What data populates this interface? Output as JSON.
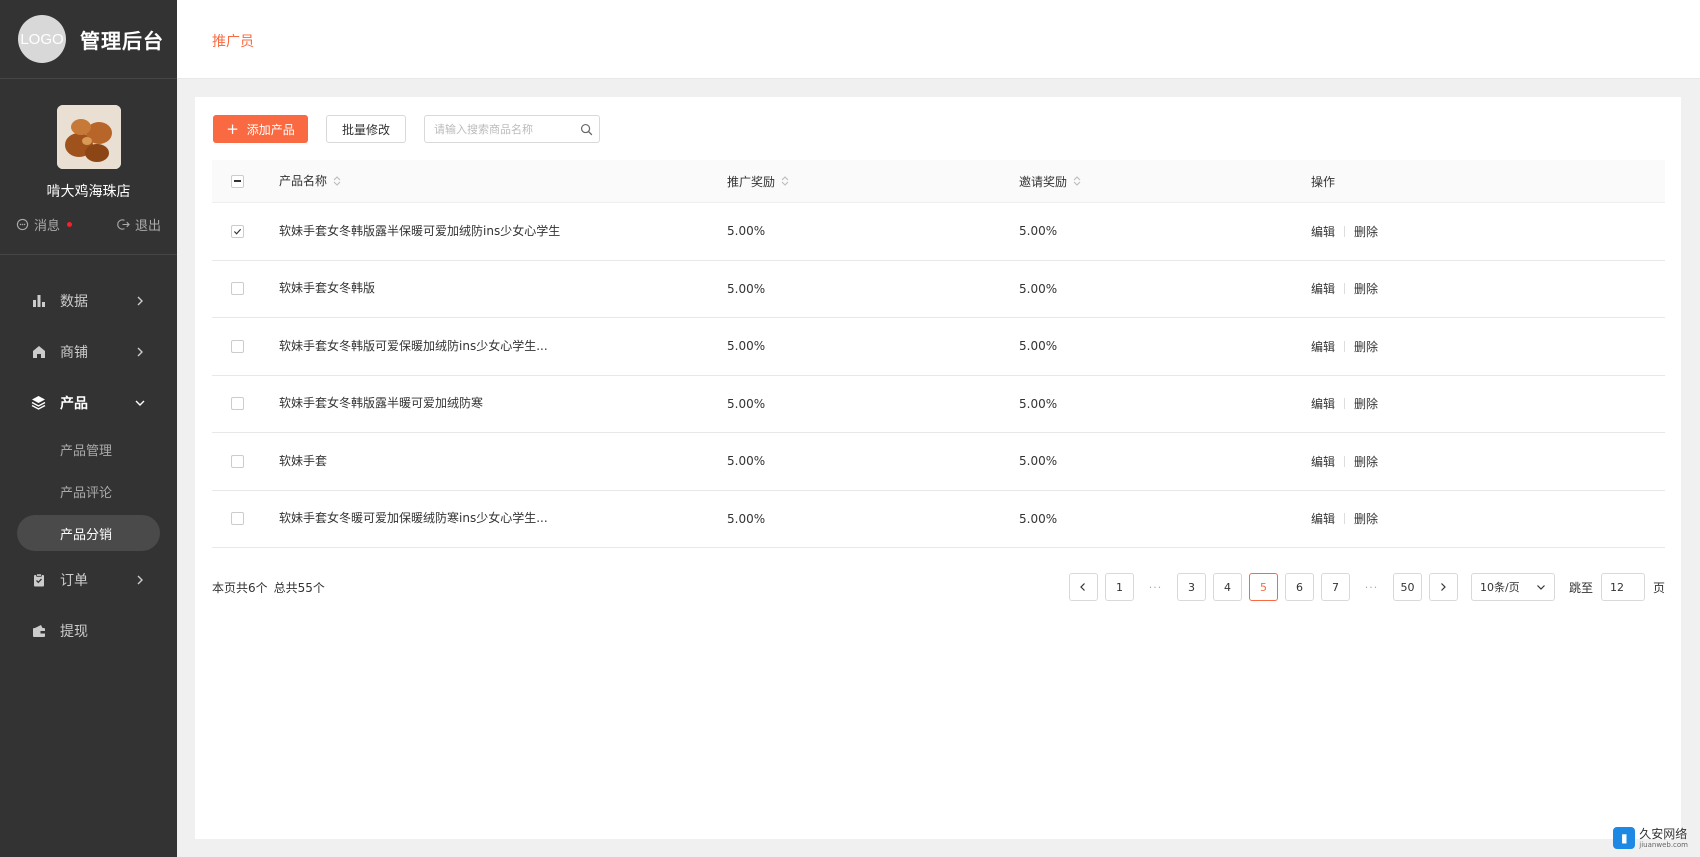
{
  "brand": {
    "logo_text": "LOGO",
    "title": "管理后台"
  },
  "profile": {
    "shop_name": "啃大鸡海珠店",
    "messages_label": "消息",
    "logout_label": "退出"
  },
  "menu": {
    "data": "数据",
    "shop": "商铺",
    "product": "产品",
    "product_sub": [
      "产品管理",
      "产品评论",
      "产品分销"
    ],
    "orders": "订单",
    "withdraw": "提现"
  },
  "header": {
    "title": "推广员"
  },
  "toolbar": {
    "add_label": "添加产品",
    "batch_label": "批量修改",
    "search_placeholder": "请输入搜索商品名称"
  },
  "table": {
    "columns": {
      "name": "产品名称",
      "promo": "推广奖励",
      "invite": "邀请奖励",
      "ops": "操作"
    },
    "edit_label": "编辑",
    "delete_label": "删除",
    "rows": [
      {
        "name": "软妹手套女冬韩版露半保暖可爱加绒防ins少女心学生",
        "promo": "5.00%",
        "invite": "5.00%",
        "checked": true
      },
      {
        "name": "软妹手套女冬韩版",
        "promo": "5.00%",
        "invite": "5.00%",
        "checked": false
      },
      {
        "name": "软妹手套女冬韩版可爱保暖加绒防ins少女心学生...",
        "promo": "5.00%",
        "invite": "5.00%",
        "checked": false
      },
      {
        "name": "软妹手套女冬韩版露半暖可爱加绒防寒",
        "promo": "5.00%",
        "invite": "5.00%",
        "checked": false
      },
      {
        "name": "软妹手套",
        "promo": "5.00%",
        "invite": "5.00%",
        "checked": false
      },
      {
        "name": "软妹手套女冬暖可爱加保暖绒防寒ins少女心学生...",
        "promo": "5.00%",
        "invite": "5.00%",
        "checked": false
      }
    ]
  },
  "footer": {
    "page_count": "本页共6个",
    "total": "总共55个",
    "pages": [
      "1",
      "3",
      "4",
      "5",
      "6",
      "7",
      "50"
    ],
    "current_page": "5",
    "ellipsis": "···",
    "page_size": "10条/页",
    "jump_label": "跳至",
    "jump_value": "12",
    "page_suffix": "页"
  },
  "watermark": {
    "main": "久安网络",
    "sub": "jiuanweb.com"
  },
  "colors": {
    "accent": "#fa6a42",
    "sidebar": "#333333"
  }
}
